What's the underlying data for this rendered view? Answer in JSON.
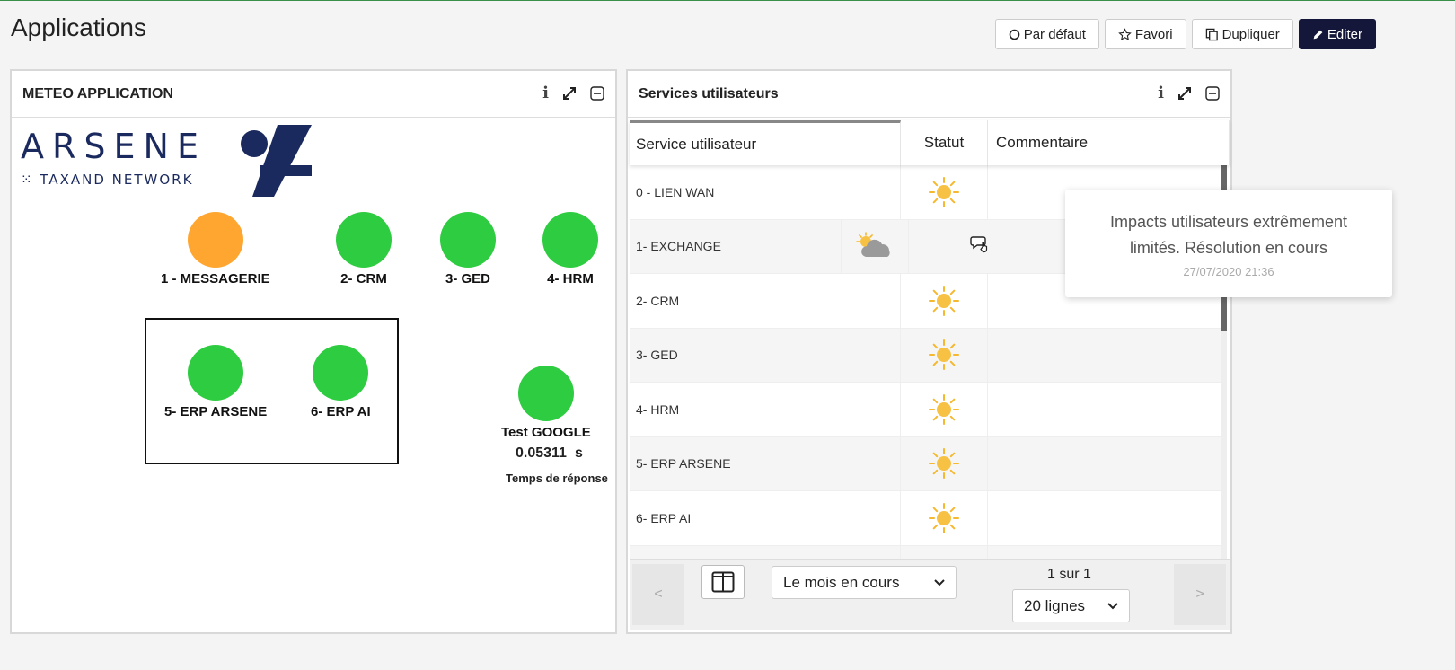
{
  "page": {
    "title": "Applications"
  },
  "toolbar": {
    "default_label": "Par défaut",
    "favorite_label": "Favori",
    "duplicate_label": "Dupliquer",
    "edit_label": "Editer"
  },
  "meteo_panel": {
    "title": "METEO APPLICATION",
    "logo": {
      "name": "ARSENE",
      "subtitle": "TAXAND NETWORK"
    },
    "colors": {
      "green": "#2ecc40",
      "orange": "#ffa630"
    },
    "apps": [
      {
        "label": "1 - MESSAGERIE",
        "status": "orange"
      },
      {
        "label": "2- CRM",
        "status": "green"
      },
      {
        "label": "3- GED",
        "status": "green"
      },
      {
        "label": "4- HRM",
        "status": "green"
      },
      {
        "label": "5- ERP ARSENE",
        "status": "green"
      },
      {
        "label": "6- ERP AI",
        "status": "green"
      },
      {
        "label": "Test GOOGLE",
        "status": "green"
      }
    ],
    "response": {
      "value": "0.05311",
      "unit": "s",
      "label": "Temps de réponse"
    }
  },
  "services_panel": {
    "title": "Services utilisateurs",
    "columns": [
      "Service utilisateur",
      "Statut",
      "Commentaire"
    ],
    "rows": [
      {
        "service": "0 - LIEN WAN",
        "status": "sun-icon",
        "has_comment": false
      },
      {
        "service": "1- EXCHANGE",
        "status": "sun-cloud-icon",
        "has_comment": true
      },
      {
        "service": "2- CRM",
        "status": "sun-icon",
        "has_comment": false
      },
      {
        "service": "3- GED",
        "status": "sun-icon",
        "has_comment": false
      },
      {
        "service": "4- HRM",
        "status": "sun-icon",
        "has_comment": false
      },
      {
        "service": "5- ERP ARSENE",
        "status": "sun-icon",
        "has_comment": false
      },
      {
        "service": "6- ERP AI",
        "status": "sun-icon",
        "has_comment": false
      }
    ],
    "pager": {
      "prev": "<",
      "next": ">",
      "period": "Le mois en cours",
      "page_info": "1 sur 1",
      "rows_per_page": "20 lignes"
    }
  },
  "tooltip": {
    "text_line1": "Impacts utilisateurs extrêmement",
    "text_line2": "limités. Résolution en cours",
    "date": "27/07/2020 21:36"
  }
}
